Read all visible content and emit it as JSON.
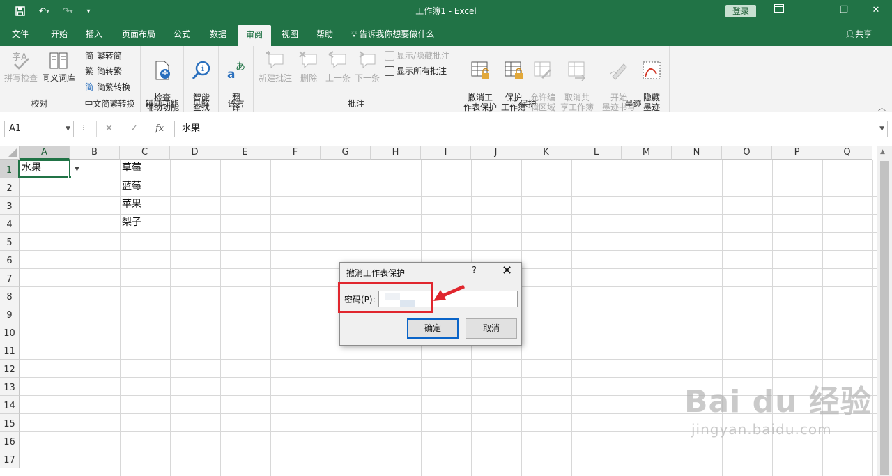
{
  "titlebar": {
    "title": "工作簿1  -  Excel",
    "login": "登录"
  },
  "tabs": [
    "文件",
    "开始",
    "插入",
    "页面布局",
    "公式",
    "数据",
    "审阅",
    "视图",
    "帮助"
  ],
  "tell_me": "告诉我你想要做什么",
  "share": "共享",
  "ribbon": {
    "proofing": {
      "label": "校对",
      "spell": "拼写检查",
      "thesaurus": "同义词库"
    },
    "chinese": {
      "label": "中文简繁转换",
      "to_simplified": "繁转简",
      "to_traditional": "简转繁",
      "convert": "简繁转换"
    },
    "accessibility": {
      "label": "辅助功能",
      "check": "检查\n辅助功能"
    },
    "insights": {
      "label": "见解",
      "smart_lookup": "智能\n查找"
    },
    "language": {
      "label": "语言",
      "translate": "翻\n译"
    },
    "comments": {
      "label": "批注",
      "new": "新建批注",
      "delete": "删除",
      "prev": "上一条",
      "next": "下一条",
      "show_hide": "显示/隐藏批注",
      "show_all": "显示所有批注"
    },
    "protect": {
      "label": "保护",
      "unprotect_sheet": "撤消工\n作表保护",
      "protect_workbook": "保护\n工作簿",
      "allow_edit": "允许编\n辑区域",
      "unshare": "取消共\n享工作簿"
    },
    "ink": {
      "label": "墨迹",
      "start_ink": "开始\n墨迹书写",
      "hide_ink": "隐藏\n墨迹"
    }
  },
  "formula_bar": {
    "name_box": "A1",
    "content": "水果"
  },
  "columns": [
    "A",
    "B",
    "C",
    "D",
    "E",
    "F",
    "G",
    "H",
    "I",
    "J",
    "K",
    "L",
    "M",
    "N",
    "O",
    "P",
    "Q"
  ],
  "rows": [
    "1",
    "2",
    "3",
    "4",
    "5",
    "6",
    "7",
    "8",
    "9",
    "10",
    "11",
    "12",
    "13",
    "14",
    "15",
    "16",
    "17"
  ],
  "cells": {
    "A1": "水果",
    "C1": "草莓",
    "C2": "蓝莓",
    "C3": "苹果",
    "C4": "梨子"
  },
  "dialog": {
    "title": "撤消工作表保护",
    "help": "?",
    "password_label": "密码(P):",
    "ok": "确定",
    "cancel": "取消"
  },
  "watermark": {
    "brand": "Bai du 经验",
    "url": "jingyan.baidu.com"
  },
  "colors": {
    "excel_green": "#217346",
    "highlight_red": "#e0262e"
  }
}
